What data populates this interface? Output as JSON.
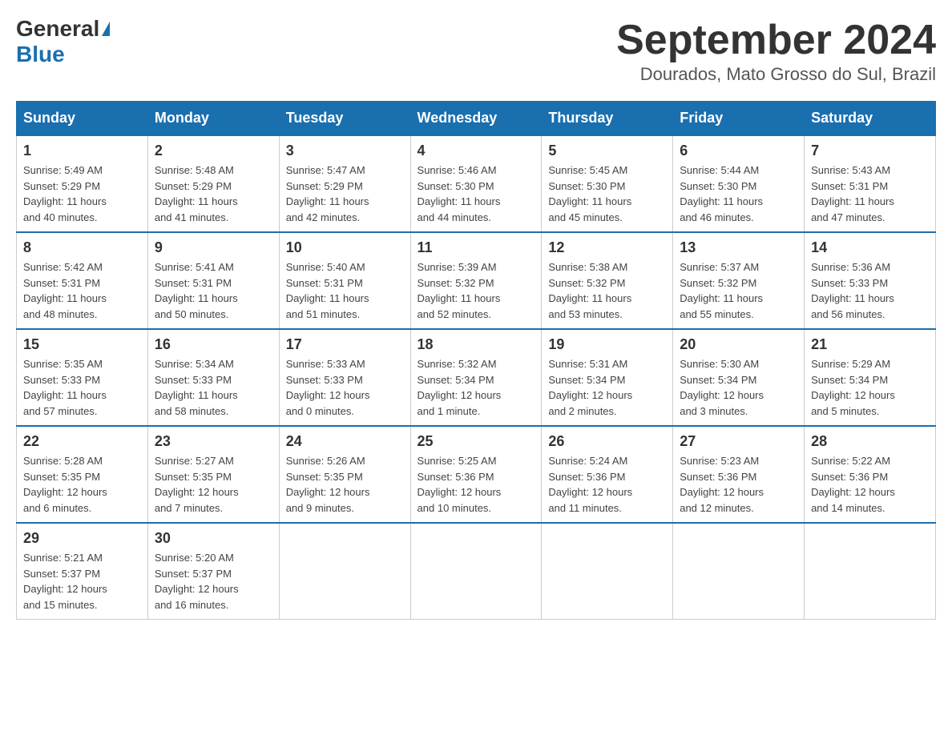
{
  "header": {
    "logo_general": "General",
    "logo_blue": "Blue",
    "month_title": "September 2024",
    "location": "Dourados, Mato Grosso do Sul, Brazil"
  },
  "days_of_week": [
    "Sunday",
    "Monday",
    "Tuesday",
    "Wednesday",
    "Thursday",
    "Friday",
    "Saturday"
  ],
  "weeks": [
    [
      {
        "day": "1",
        "sunrise": "5:49 AM",
        "sunset": "5:29 PM",
        "daylight": "11 hours and 40 minutes."
      },
      {
        "day": "2",
        "sunrise": "5:48 AM",
        "sunset": "5:29 PM",
        "daylight": "11 hours and 41 minutes."
      },
      {
        "day": "3",
        "sunrise": "5:47 AM",
        "sunset": "5:29 PM",
        "daylight": "11 hours and 42 minutes."
      },
      {
        "day": "4",
        "sunrise": "5:46 AM",
        "sunset": "5:30 PM",
        "daylight": "11 hours and 44 minutes."
      },
      {
        "day": "5",
        "sunrise": "5:45 AM",
        "sunset": "5:30 PM",
        "daylight": "11 hours and 45 minutes."
      },
      {
        "day": "6",
        "sunrise": "5:44 AM",
        "sunset": "5:30 PM",
        "daylight": "11 hours and 46 minutes."
      },
      {
        "day": "7",
        "sunrise": "5:43 AM",
        "sunset": "5:31 PM",
        "daylight": "11 hours and 47 minutes."
      }
    ],
    [
      {
        "day": "8",
        "sunrise": "5:42 AM",
        "sunset": "5:31 PM",
        "daylight": "11 hours and 48 minutes."
      },
      {
        "day": "9",
        "sunrise": "5:41 AM",
        "sunset": "5:31 PM",
        "daylight": "11 hours and 50 minutes."
      },
      {
        "day": "10",
        "sunrise": "5:40 AM",
        "sunset": "5:31 PM",
        "daylight": "11 hours and 51 minutes."
      },
      {
        "day": "11",
        "sunrise": "5:39 AM",
        "sunset": "5:32 PM",
        "daylight": "11 hours and 52 minutes."
      },
      {
        "day": "12",
        "sunrise": "5:38 AM",
        "sunset": "5:32 PM",
        "daylight": "11 hours and 53 minutes."
      },
      {
        "day": "13",
        "sunrise": "5:37 AM",
        "sunset": "5:32 PM",
        "daylight": "11 hours and 55 minutes."
      },
      {
        "day": "14",
        "sunrise": "5:36 AM",
        "sunset": "5:33 PM",
        "daylight": "11 hours and 56 minutes."
      }
    ],
    [
      {
        "day": "15",
        "sunrise": "5:35 AM",
        "sunset": "5:33 PM",
        "daylight": "11 hours and 57 minutes."
      },
      {
        "day": "16",
        "sunrise": "5:34 AM",
        "sunset": "5:33 PM",
        "daylight": "11 hours and 58 minutes."
      },
      {
        "day": "17",
        "sunrise": "5:33 AM",
        "sunset": "5:33 PM",
        "daylight": "12 hours and 0 minutes."
      },
      {
        "day": "18",
        "sunrise": "5:32 AM",
        "sunset": "5:34 PM",
        "daylight": "12 hours and 1 minute."
      },
      {
        "day": "19",
        "sunrise": "5:31 AM",
        "sunset": "5:34 PM",
        "daylight": "12 hours and 2 minutes."
      },
      {
        "day": "20",
        "sunrise": "5:30 AM",
        "sunset": "5:34 PM",
        "daylight": "12 hours and 3 minutes."
      },
      {
        "day": "21",
        "sunrise": "5:29 AM",
        "sunset": "5:34 PM",
        "daylight": "12 hours and 5 minutes."
      }
    ],
    [
      {
        "day": "22",
        "sunrise": "5:28 AM",
        "sunset": "5:35 PM",
        "daylight": "12 hours and 6 minutes."
      },
      {
        "day": "23",
        "sunrise": "5:27 AM",
        "sunset": "5:35 PM",
        "daylight": "12 hours and 7 minutes."
      },
      {
        "day": "24",
        "sunrise": "5:26 AM",
        "sunset": "5:35 PM",
        "daylight": "12 hours and 9 minutes."
      },
      {
        "day": "25",
        "sunrise": "5:25 AM",
        "sunset": "5:36 PM",
        "daylight": "12 hours and 10 minutes."
      },
      {
        "day": "26",
        "sunrise": "5:24 AM",
        "sunset": "5:36 PM",
        "daylight": "12 hours and 11 minutes."
      },
      {
        "day": "27",
        "sunrise": "5:23 AM",
        "sunset": "5:36 PM",
        "daylight": "12 hours and 12 minutes."
      },
      {
        "day": "28",
        "sunrise": "5:22 AM",
        "sunset": "5:36 PM",
        "daylight": "12 hours and 14 minutes."
      }
    ],
    [
      {
        "day": "29",
        "sunrise": "5:21 AM",
        "sunset": "5:37 PM",
        "daylight": "12 hours and 15 minutes."
      },
      {
        "day": "30",
        "sunrise": "5:20 AM",
        "sunset": "5:37 PM",
        "daylight": "12 hours and 16 minutes."
      },
      null,
      null,
      null,
      null,
      null
    ]
  ],
  "labels": {
    "sunrise": "Sunrise:",
    "sunset": "Sunset:",
    "daylight": "Daylight:"
  }
}
